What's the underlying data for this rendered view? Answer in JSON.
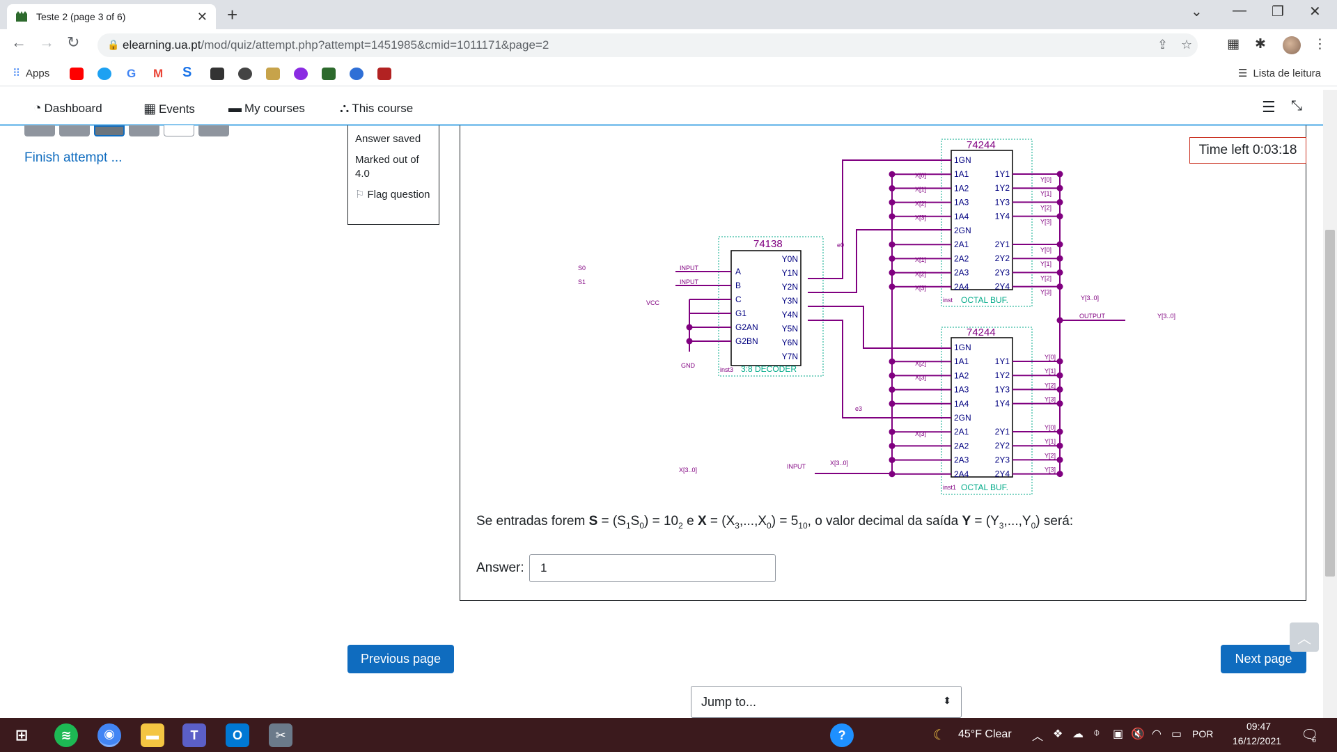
{
  "browser": {
    "tab_title": "Teste 2 (page 3 of 6)",
    "url_host": "elearning.ua.pt",
    "url_path": "/mod/quiz/attempt.php?attempt=1451985&cmid=1011171&page=2",
    "bookmarks_apps": "Apps",
    "reading_list": "Lista de leitura"
  },
  "nav": {
    "dashboard": "Dashboard",
    "events": "Events",
    "my_courses": "My courses",
    "this_course": "This course"
  },
  "sidebar": {
    "finish_attempt": "Finish attempt ..."
  },
  "info": {
    "state": "Answer saved",
    "marked": "Marked out of 4.0",
    "flag": "Flag question"
  },
  "timer": "Time left 0:03:18",
  "circuit": {
    "top_chip": "74244",
    "bottom_chip": "74244",
    "decoder_chip": "74138",
    "decoder_name": "3:8 DECODER",
    "decoder_inst": "inst3",
    "buf_name": "OCTAL BUF.",
    "buf_inst_top": "inst",
    "buf_inst_bottom": "inst1",
    "decoder_inputs": [
      "A",
      "B",
      "C",
      "G1",
      "G2AN",
      "G2BN"
    ],
    "decoder_outputs": [
      "Y0N",
      "Y1N",
      "Y2N",
      "Y3N",
      "Y4N",
      "Y5N",
      "Y6N",
      "Y7N"
    ],
    "buf_left_pins": [
      "1GN",
      "1A1",
      "1A2",
      "1A3",
      "1A4",
      "2GN",
      "2A1",
      "2A2",
      "2A3",
      "2A4"
    ],
    "buf_right_pins": [
      "1Y1",
      "1Y2",
      "1Y3",
      "1Y4",
      "2Y1",
      "2Y2",
      "2Y3",
      "2Y4"
    ],
    "s0": "S0",
    "s1": "S1",
    "input": "INPUT",
    "vcc": "VCC",
    "gnd": "GND",
    "output": "OUTPUT",
    "x_bus": "X[3..0]",
    "y_bus": "Y[3..0]",
    "x_labels_top": [
      "X[0]",
      "X[1]",
      "X[2]",
      "X[3]",
      "X[1]",
      "X[2]",
      "X[3]"
    ],
    "x_labels_bottom": [
      "X[2]",
      "X[3]",
      "X[3]"
    ],
    "y_labels_top": [
      "Y[0]",
      "Y[1]",
      "Y[2]",
      "Y[3]",
      "Y[0]",
      "Y[1]",
      "Y[2]",
      "Y[3]"
    ],
    "y_labels_bottom": [
      "Y[0]",
      "Y[1]",
      "Y[2]",
      "Y[3]",
      "Y[0]",
      "Y[1]",
      "Y[2]",
      "Y[3]"
    ],
    "e0": "e0",
    "e3": "e3"
  },
  "question": {
    "text_pre": "Se entradas forem ",
    "answer_label": "Answer:",
    "answer_value": "1"
  },
  "buttons": {
    "previous": "Previous page",
    "next": "Next page",
    "jump": "Jump to..."
  },
  "taskbar": {
    "weather": "45°F  Clear",
    "lang": "POR",
    "time": "09:47",
    "date": "16/12/2021",
    "notif_count": "6"
  }
}
